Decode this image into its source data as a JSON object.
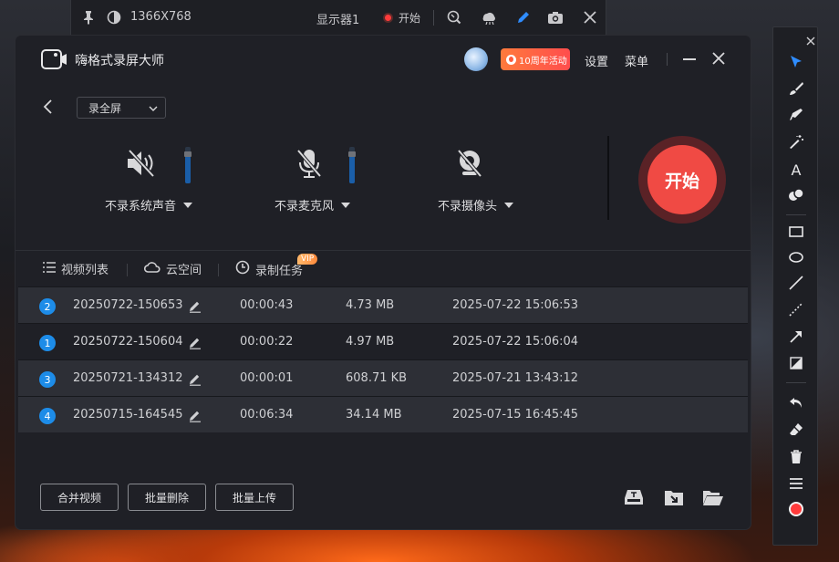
{
  "top_toolbar": {
    "resolution": "1366X768",
    "monitor": "显示器1",
    "record_label": "开始"
  },
  "window": {
    "title": "嗨格式录屏大师",
    "promo_badge": "10周年活动",
    "settings": "设置",
    "menu": "菜单"
  },
  "mode": {
    "selected": "录全屏"
  },
  "devices": {
    "system_audio": "不录系统声音",
    "microphone": "不录麦克风",
    "camera": "不录摄像头",
    "system_audio_level": 0.75,
    "microphone_level": 0.75
  },
  "start_button": "开始",
  "tabs": {
    "video_list": "视频列表",
    "cloud": "云空间",
    "tasks": "录制任务",
    "vip": "VIP"
  },
  "videos": [
    {
      "index": "2",
      "name": "20250722-150653",
      "duration": "00:00:43",
      "size": "4.73 MB",
      "date": "2025-07-22 15:06:53"
    },
    {
      "index": "1",
      "name": "20250722-150604",
      "duration": "00:00:22",
      "size": "4.97 MB",
      "date": "2025-07-22 15:06:04"
    },
    {
      "index": "3",
      "name": "20250721-134312",
      "duration": "00:00:01",
      "size": "608.71 KB",
      "date": "2025-07-21 13:43:12"
    },
    {
      "index": "4",
      "name": "20250715-164545",
      "duration": "00:06:34",
      "size": "34.14 MB",
      "date": "2025-07-15 16:45:45"
    }
  ],
  "bottom": {
    "merge": "合并视频",
    "batch_delete": "批量删除",
    "batch_upload": "批量上传"
  },
  "side_toolbar": {
    "text_tool": "A"
  },
  "colors": {
    "accent_red": "#f04a44",
    "index_blue": "#1d8ce8",
    "pen_blue": "#2f8cff"
  }
}
